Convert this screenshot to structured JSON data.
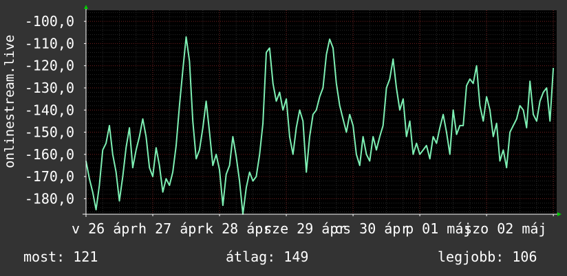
{
  "chart_data": {
    "type": "line",
    "ylabel": "onlinestream.live",
    "ylim": [
      -187,
      -95
    ],
    "yticks": [
      -100,
      -110,
      -120,
      -130,
      -140,
      -150,
      -160,
      -170,
      -180
    ],
    "ytick_labels": [
      "-100,0",
      "-110,0",
      "-120,0",
      "-130,0",
      "-140,0",
      "-150,0",
      "-160,0",
      "-170,0",
      "-180,0"
    ],
    "xlim": [
      0,
      7.05
    ],
    "xtick_labels": [
      {
        "pos": 0.28,
        "label": "v 26 ápr"
      },
      {
        "pos": 1.28,
        "label": "h 27 ápr"
      },
      {
        "pos": 2.28,
        "label": "k 28 ápr"
      },
      {
        "pos": 3.28,
        "label": "sze 29 ápr"
      },
      {
        "pos": 4.28,
        "label": "cs 30 ápr"
      },
      {
        "pos": 5.28,
        "label": "p 01 máj"
      },
      {
        "pos": 6.28,
        "label": "szo 02 máj"
      }
    ],
    "grid": true,
    "colors": {
      "background": "#333333",
      "plot": "#000000",
      "line": "#7ef0b4",
      "grid_major": "#7a2222",
      "grid_minor": "#2a2a2a",
      "text": "#ffffff",
      "axis": "#ffffff",
      "arrow": "#00cc00"
    },
    "series": [
      {
        "x": [
          0.0,
          0.05,
          0.1,
          0.15,
          0.2,
          0.25,
          0.3,
          0.35,
          0.4,
          0.45,
          0.5,
          0.55,
          0.6,
          0.65,
          0.7,
          0.75,
          0.8,
          0.85,
          0.9,
          0.95,
          1.0,
          1.05,
          1.1,
          1.15,
          1.2,
          1.25,
          1.3,
          1.35,
          1.4,
          1.45,
          1.5,
          1.55,
          1.6,
          1.65,
          1.7,
          1.75,
          1.8,
          1.85,
          1.9,
          1.95,
          2.0,
          2.05,
          2.1,
          2.15,
          2.2,
          2.25,
          2.3,
          2.35,
          2.4,
          2.45,
          2.5,
          2.55,
          2.6,
          2.65,
          2.7,
          2.75,
          2.8,
          2.85,
          2.9,
          2.95,
          3.0,
          3.05,
          3.1,
          3.15,
          3.2,
          3.25,
          3.3,
          3.35,
          3.4,
          3.45,
          3.5,
          3.55,
          3.6,
          3.65,
          3.7,
          3.75,
          3.8,
          3.85,
          3.9,
          3.95,
          4.0,
          4.05,
          4.1,
          4.15,
          4.2,
          4.25,
          4.3,
          4.35,
          4.4,
          4.45,
          4.5,
          4.55,
          4.6,
          4.65,
          4.7,
          4.75,
          4.8,
          4.85,
          4.9,
          4.95,
          5.0,
          5.05,
          5.1,
          5.15,
          5.2,
          5.25,
          5.3,
          5.35,
          5.4,
          5.45,
          5.5,
          5.55,
          5.6,
          5.65,
          5.7,
          5.75,
          5.8,
          5.85,
          5.9,
          5.95,
          6.0,
          6.05,
          6.1,
          6.15,
          6.2,
          6.25,
          6.3,
          6.35,
          6.4,
          6.45,
          6.5,
          6.55,
          6.6,
          6.65,
          6.7,
          6.75,
          6.8,
          6.85,
          6.9,
          6.95,
          7.0
        ],
        "values": [
          -163,
          -171,
          -177,
          -185,
          -174,
          -158,
          -155,
          -147,
          -160,
          -168,
          -181,
          -170,
          -157,
          -148,
          -166,
          -158,
          -152,
          -144,
          -152,
          -166,
          -170,
          -157,
          -165,
          -177,
          -171,
          -174,
          -168,
          -156,
          -138,
          -122,
          -107,
          -118,
          -145,
          -162,
          -158,
          -148,
          -136,
          -150,
          -165,
          -160,
          -167,
          -183,
          -169,
          -165,
          -152,
          -161,
          -172,
          -187,
          -175,
          -168,
          -172,
          -170,
          -160,
          -146,
          -114,
          -112,
          -128,
          -136,
          -132,
          -140,
          -135,
          -152,
          -160,
          -148,
          -140,
          -145,
          -168,
          -152,
          -142,
          -140,
          -134,
          -130,
          -115,
          -108,
          -112,
          -128,
          -138,
          -144,
          -150,
          -142,
          -147,
          -160,
          -165,
          -152,
          -160,
          -163,
          -152,
          -158,
          -152,
          -147,
          -130,
          -126,
          -117,
          -130,
          -140,
          -135,
          -152,
          -145,
          -160,
          -155,
          -160,
          -158,
          -156,
          -162,
          -152,
          -155,
          -148,
          -142,
          -150,
          -160,
          -140,
          -151,
          -147,
          -147,
          -129,
          -126,
          -128,
          -120,
          -138,
          -145,
          -134,
          -140,
          -152,
          -146,
          -163,
          -158,
          -166,
          -150,
          -147,
          -144,
          -138,
          -140,
          -148,
          -127,
          -142,
          -145,
          -136,
          -132,
          -130,
          -145,
          -121
        ]
      }
    ]
  },
  "footer": {
    "now": "most: 121",
    "avg": "átlag: 149",
    "best": "legjobb: 106"
  }
}
